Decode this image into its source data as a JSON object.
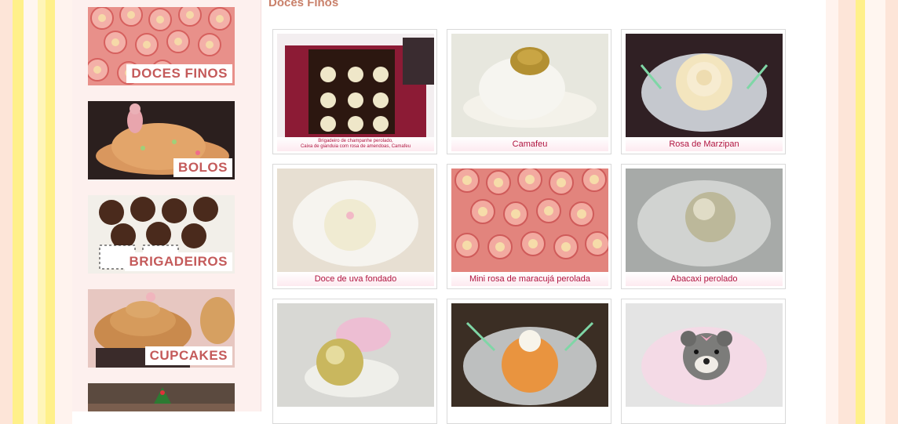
{
  "section_title": "Doces Finos",
  "categories": [
    {
      "label": "DOCES FINOS"
    },
    {
      "label": "BOLOS"
    },
    {
      "label": "BRIGADEIROS"
    },
    {
      "label": "CUPCAKES"
    }
  ],
  "products": [
    {
      "caption": "Brigadeiro de champanhe perolado,\nCaixa de gianduia com rosa de amendoas, Camafeu"
    },
    {
      "caption": "Camafeu"
    },
    {
      "caption": "Rosa de Marzipan"
    },
    {
      "caption": "Doce de uva fondado"
    },
    {
      "caption": "Mini rosa de maracujá perolada"
    },
    {
      "caption": "Abacaxi perolado"
    }
  ]
}
